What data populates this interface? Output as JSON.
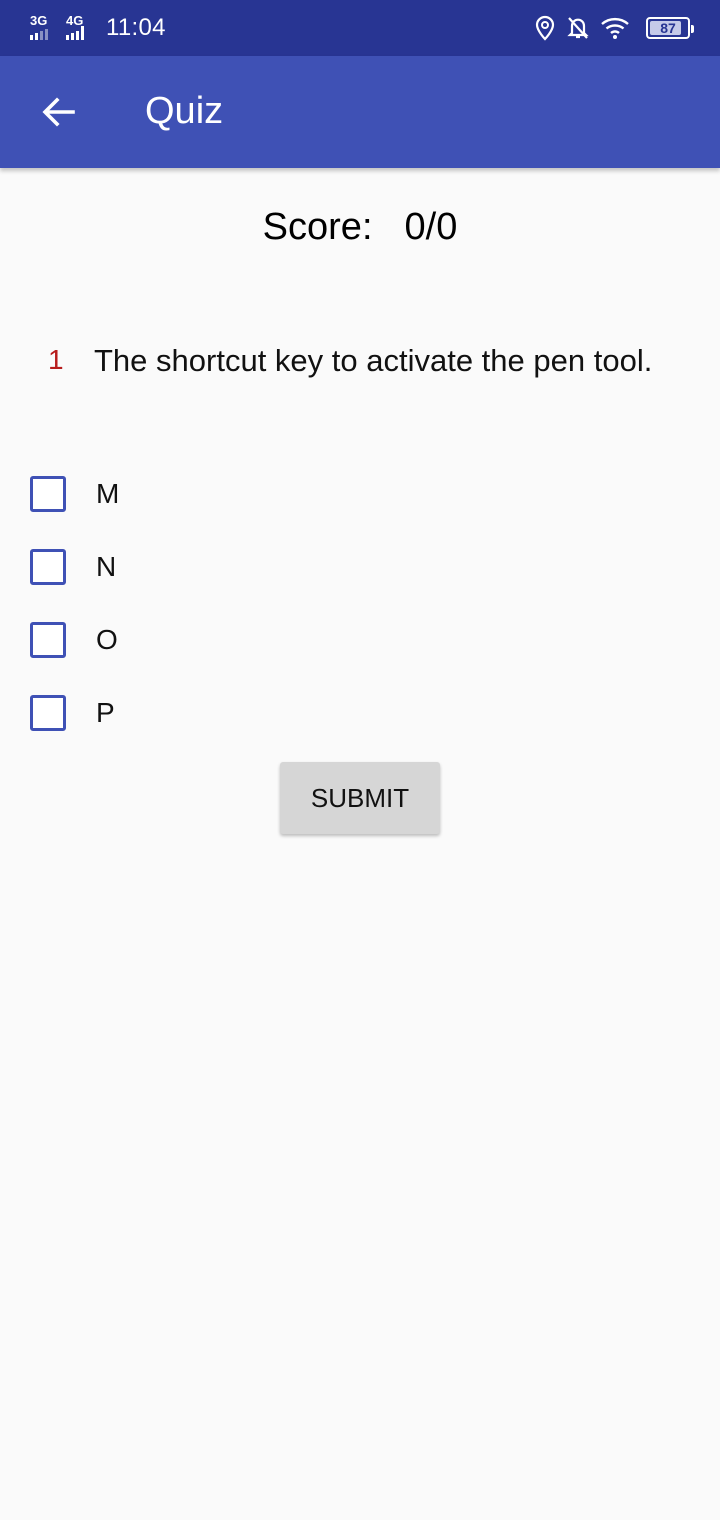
{
  "status_bar": {
    "network1": "3G",
    "network2": "4G",
    "time": "11:04",
    "battery": "87",
    "battery_level": 0.87,
    "icons": [
      "location-icon",
      "notifications-off-icon",
      "wifi-icon",
      "battery-icon"
    ]
  },
  "app_bar": {
    "back_icon": "arrow-back-icon",
    "title": "Quiz"
  },
  "score": {
    "label": "Score:",
    "value": "0/0"
  },
  "question": {
    "number": "1",
    "text": "The shortcut key to activate the pen tool."
  },
  "options": [
    {
      "label": "M",
      "checked": false
    },
    {
      "label": "N",
      "checked": false
    },
    {
      "label": "O",
      "checked": false
    },
    {
      "label": "P",
      "checked": false
    }
  ],
  "submit_label": "SUBMIT",
  "colors": {
    "status_bar": "#283593",
    "app_bar": "#3f51b5",
    "checkbox": "#3f51b5",
    "question_number": "#b71c1c",
    "button": "#d6d6d6"
  }
}
